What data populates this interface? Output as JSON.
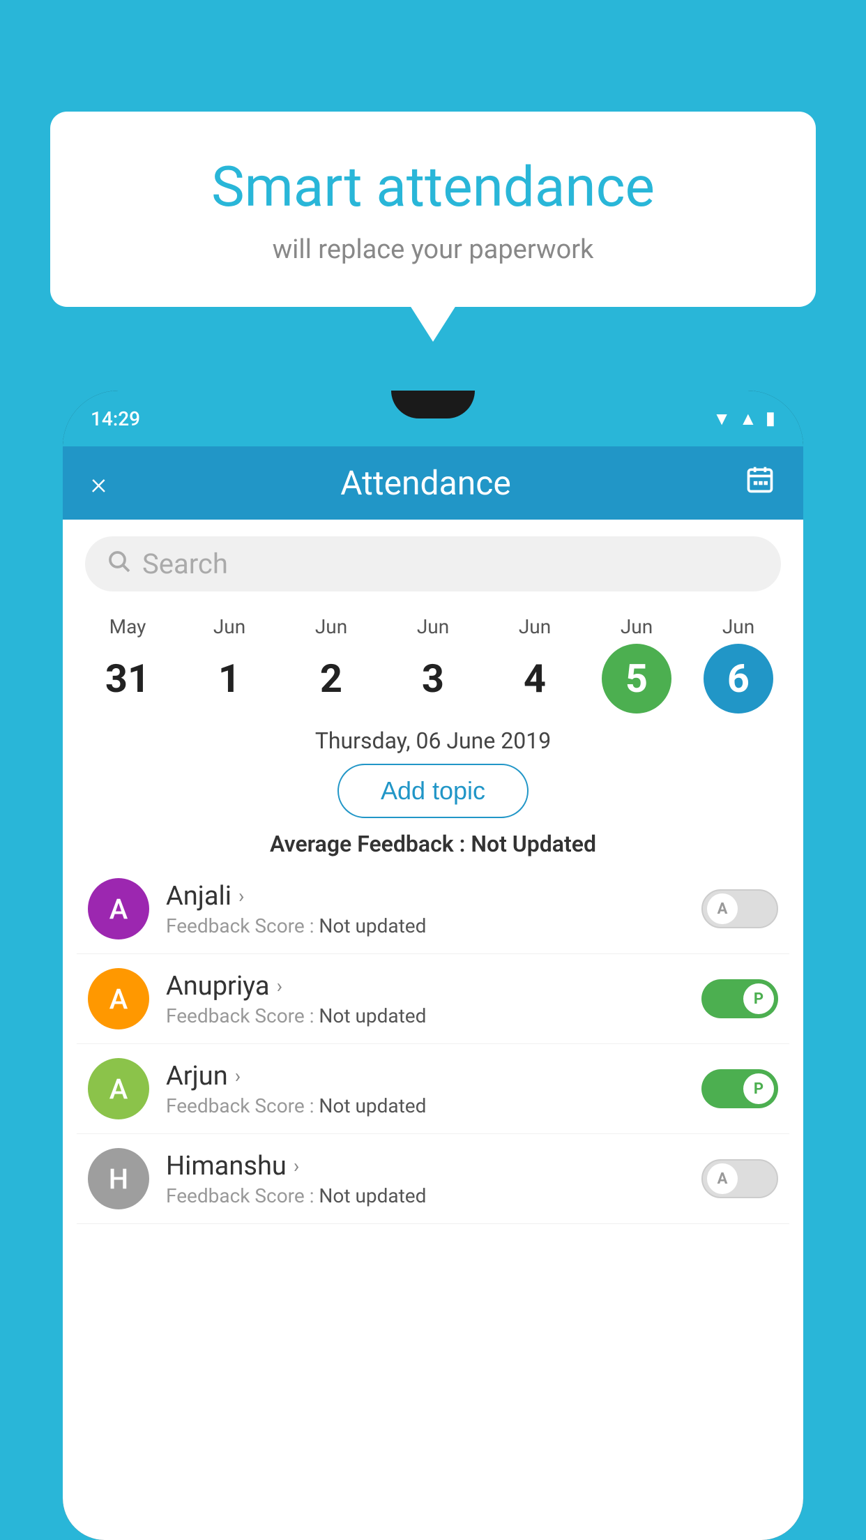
{
  "background_color": "#29B6D8",
  "bubble": {
    "title": "Smart attendance",
    "subtitle": "will replace your paperwork"
  },
  "status_bar": {
    "time": "14:29",
    "icons": [
      "wifi",
      "signal",
      "battery"
    ]
  },
  "header": {
    "title": "Attendance",
    "close_label": "×",
    "calendar_icon": "📅"
  },
  "search": {
    "placeholder": "Search"
  },
  "calendar": {
    "days": [
      {
        "month": "May",
        "num": "31",
        "state": "normal"
      },
      {
        "month": "Jun",
        "num": "1",
        "state": "normal"
      },
      {
        "month": "Jun",
        "num": "2",
        "state": "normal"
      },
      {
        "month": "Jun",
        "num": "3",
        "state": "normal"
      },
      {
        "month": "Jun",
        "num": "4",
        "state": "normal"
      },
      {
        "month": "Jun",
        "num": "5",
        "state": "today"
      },
      {
        "month": "Jun",
        "num": "6",
        "state": "selected"
      }
    ]
  },
  "selected_date": "Thursday, 06 June 2019",
  "add_topic_label": "Add topic",
  "average_feedback": {
    "label": "Average Feedback : ",
    "value": "Not Updated"
  },
  "students": [
    {
      "name": "Anjali",
      "avatar_letter": "A",
      "avatar_color": "#9C27B0",
      "feedback": "Feedback Score : ",
      "feedback_value": "Not updated",
      "toggle_state": "off",
      "toggle_label": "A"
    },
    {
      "name": "Anupriya",
      "avatar_letter": "A",
      "avatar_color": "#FF9800",
      "feedback": "Feedback Score : ",
      "feedback_value": "Not updated",
      "toggle_state": "on",
      "toggle_label": "P"
    },
    {
      "name": "Arjun",
      "avatar_letter": "A",
      "avatar_color": "#8BC34A",
      "feedback": "Feedback Score : ",
      "feedback_value": "Not updated",
      "toggle_state": "on",
      "toggle_label": "P"
    },
    {
      "name": "Himanshu",
      "avatar_letter": "H",
      "avatar_color": "#9E9E9E",
      "feedback": "Feedback Score : ",
      "feedback_value": "Not updated",
      "toggle_state": "off",
      "toggle_label": "A"
    }
  ]
}
